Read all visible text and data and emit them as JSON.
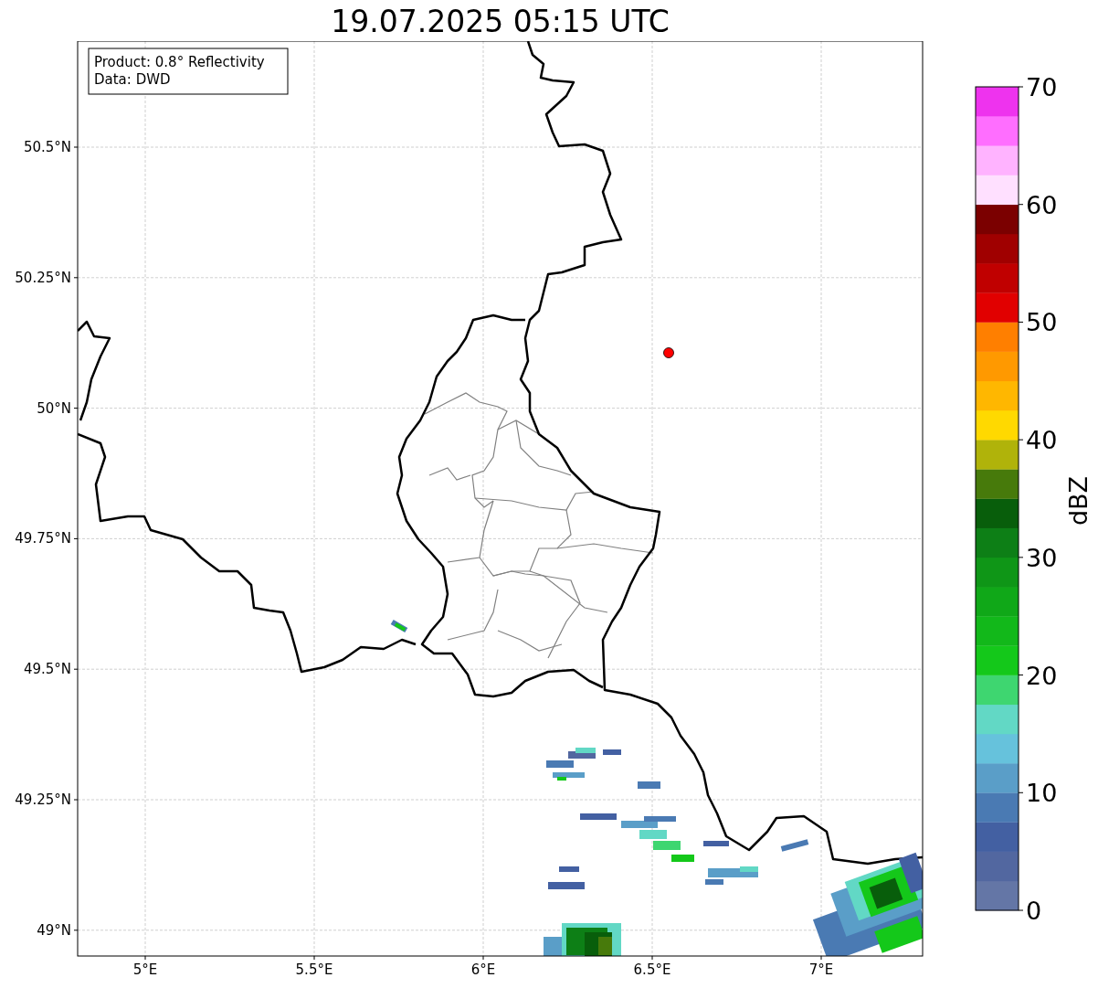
{
  "title": "19.07.2025 05:15 UTC",
  "map": {
    "x_ticks": [
      "5°E",
      "5.5°E",
      "6°E",
      "6.5°E",
      "7°E"
    ],
    "y_ticks": [
      "50.5°N",
      "50.25°N",
      "50°N",
      "49.75°N",
      "49.5°N",
      "49.25°N",
      "49°N"
    ],
    "info_box": [
      "Product: 0.8° Reflectivity",
      "Data: DWD"
    ]
  },
  "colorbar": {
    "label": "dBZ",
    "ticks": [
      "70",
      "60",
      "50",
      "40",
      "30",
      "20",
      "10",
      "0"
    ],
    "bands": [
      {
        "color": "#6476a6"
      },
      {
        "color": "#5267a0"
      },
      {
        "color": "#4360a2"
      },
      {
        "color": "#4a7ab3"
      },
      {
        "color": "#5a9ec8"
      },
      {
        "color": "#66c2dc"
      },
      {
        "color": "#62d8c5"
      },
      {
        "color": "#3ed670"
      },
      {
        "color": "#14c81a"
      },
      {
        "color": "#12b81a"
      },
      {
        "color": "#10a818"
      },
      {
        "color": "#0f9617"
      },
      {
        "color": "#0d7f16"
      },
      {
        "color": "#085e0b"
      },
      {
        "color": "#477a0b"
      },
      {
        "color": "#b0b30a"
      },
      {
        "color": "#ffd900"
      },
      {
        "color": "#ffb700"
      },
      {
        "color": "#ff9900"
      },
      {
        "color": "#ff7f00"
      },
      {
        "color": "#e10000"
      },
      {
        "color": "#c00000"
      },
      {
        "color": "#a00000"
      },
      {
        "color": "#7b0000"
      },
      {
        "color": "#ffe0ff"
      },
      {
        "color": "#ffb3ff"
      },
      {
        "color": "#ff6eff"
      },
      {
        "color": "#ee33ee"
      }
    ]
  }
}
